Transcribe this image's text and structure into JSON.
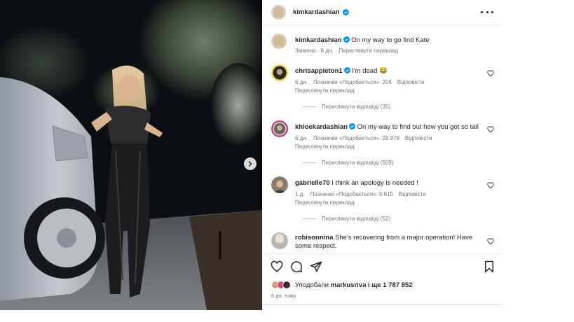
{
  "post": {
    "author": "kimkardashian",
    "verified": true,
    "caption": {
      "username": "kimkardashian",
      "text": "On my way to go find Kate",
      "edited_label": "Змінено",
      "time": "6 дн.",
      "translation_label": "Переглянути переклад"
    }
  },
  "comments": [
    {
      "username": "chrisappleton1",
      "verified": true,
      "text": "I'm dead",
      "emoji": "😂",
      "time": "6 дн.",
      "likes_label": "Позначки «Подобається»: 204",
      "reply_label": "Відповісти",
      "translation_label": "Переглянути переклад",
      "view_replies": "Переглянути відповіді (35)"
    },
    {
      "username": "khloekardashian",
      "verified": true,
      "text": "On my way to find out how you got so tall",
      "time": "6 дн.",
      "likes_label": "Позначки «Подобається»: 28 979",
      "reply_label": "Відповісти",
      "translation_label": "Переглянути переклад",
      "view_replies": "Переглянути відповіді (509)"
    },
    {
      "username": "gabrielle70",
      "verified": false,
      "text": "I think an apology is needed !",
      "time": "1 д.",
      "likes_label": "Позначки «Подобається»: 5 615",
      "reply_label": "Відповісти",
      "translation_label": "Переглянути переклад",
      "view_replies": "Переглянути відповіді (52)"
    },
    {
      "username": "robisonnina",
      "verified": false,
      "text": "She's recovering from a major operation! Have some respect."
    }
  ],
  "footer": {
    "liked_by_prefix": "Уподобали",
    "liked_by_user": "markusriva",
    "liked_by_suffix": "і ще 1 787 852",
    "time_ago": "6 дн. тому"
  },
  "icons": {
    "like": "heart-icon",
    "comment": "comment-icon",
    "share": "share-icon",
    "save": "bookmark-icon",
    "more": "more-options-icon",
    "next": "chevron-right-icon",
    "verified": "verified-badge-icon"
  },
  "colors": {
    "verified": "#0095f6",
    "text": "#262626",
    "secondary": "#737373",
    "divider": "#efefef"
  }
}
